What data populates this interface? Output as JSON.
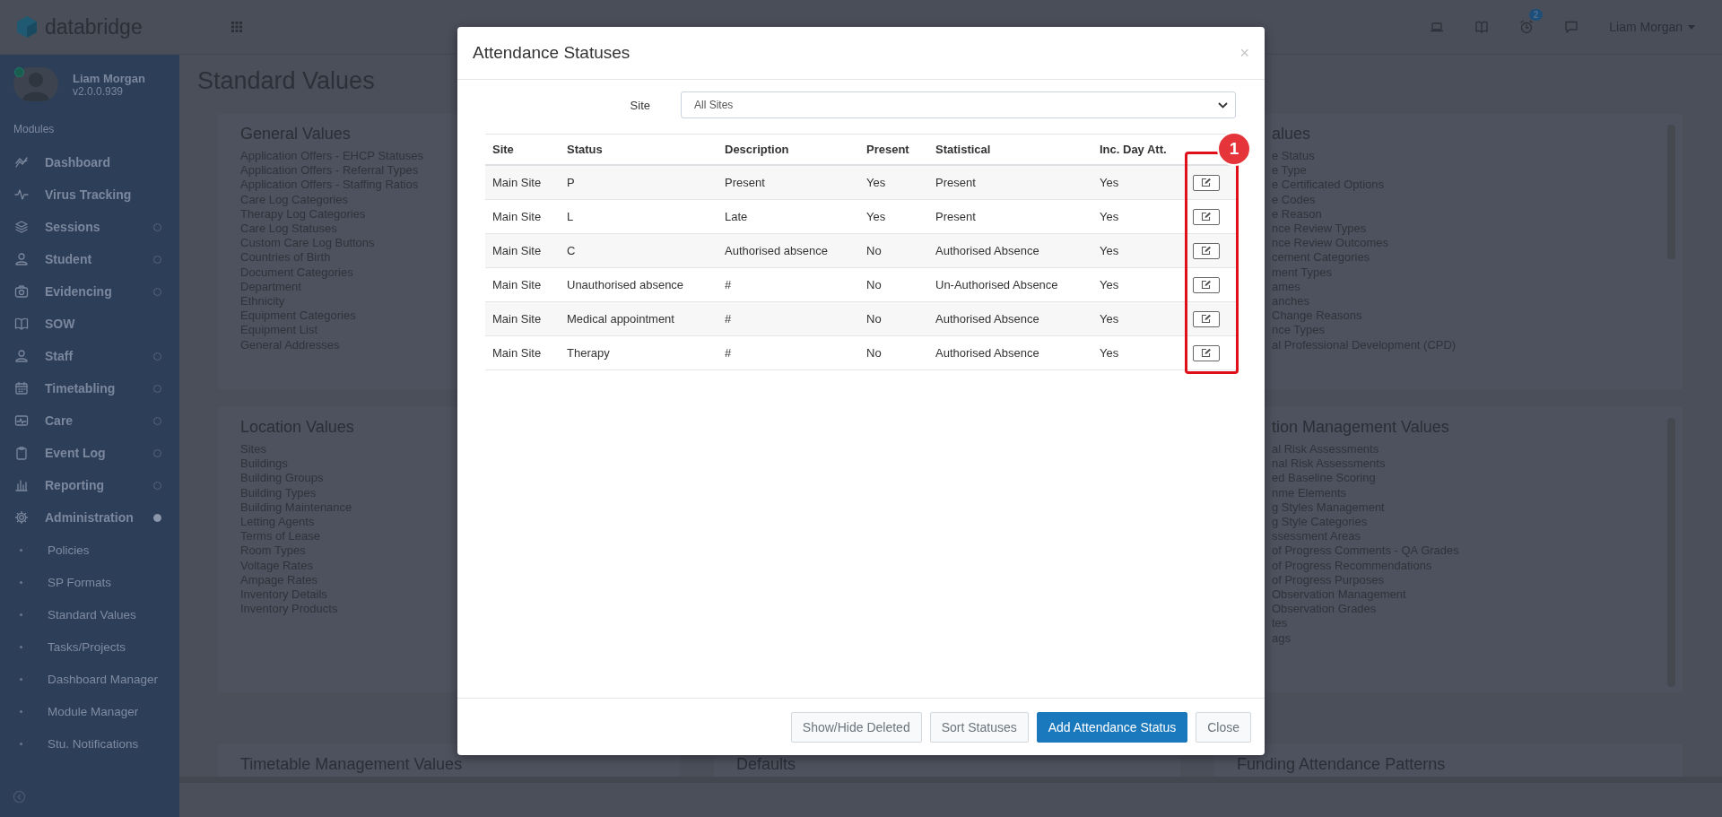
{
  "topbar": {
    "brand": "databridge",
    "notification_count": "2",
    "user_menu": "Liam Morgan"
  },
  "sidebar": {
    "user": {
      "name": "Liam Morgan",
      "version": "v2.0.0.939",
      "online": true
    },
    "section_label": "Modules",
    "items": [
      {
        "label": "Dashboard"
      },
      {
        "label": "Virus Tracking"
      },
      {
        "label": "Sessions",
        "expanded": false
      },
      {
        "label": "Student",
        "expanded": false
      },
      {
        "label": "Evidencing",
        "expanded": false
      },
      {
        "label": "SOW"
      },
      {
        "label": "Staff",
        "expanded": false
      },
      {
        "label": "Timetabling",
        "expanded": false
      },
      {
        "label": "Care",
        "expanded": false
      },
      {
        "label": "Event Log",
        "expanded": false
      },
      {
        "label": "Reporting",
        "expanded": false
      },
      {
        "label": "Administration",
        "expanded": true,
        "children": [
          {
            "label": "Policies"
          },
          {
            "label": "SP Formats"
          },
          {
            "label": "Standard Values"
          },
          {
            "label": "Tasks/Projects"
          },
          {
            "label": "Dashboard Manager"
          },
          {
            "label": "Module Manager"
          },
          {
            "label": "Stu. Notifications"
          }
        ]
      }
    ]
  },
  "page": {
    "title": "Standard Values",
    "left_cards": [
      {
        "title": "General Values",
        "links": [
          "Application Offers - EHCP Statuses",
          "Application Offers - Referral Types",
          "Application Offers - Staffing Ratios",
          "Care Log Categories",
          "Therapy Log Categories",
          "Care Log Statuses",
          "Custom Care Log Buttons",
          "Countries of Birth",
          "Document Categories",
          "Department",
          "Ethnicity",
          "Equipment Categories",
          "Equipment List",
          "General Addresses"
        ]
      },
      {
        "title": "Location Values",
        "links": [
          "Sites",
          "Buildings",
          "Building Groups",
          "Building Types",
          "Building Maintenance",
          "Letting Agents",
          "Terms of Lease",
          "Room Types",
          "Voltage Rates",
          "Ampage Rates",
          "Inventory Details",
          "Inventory Products"
        ]
      }
    ],
    "right_cards": [
      {
        "title": "alues",
        "links": [
          "e Status",
          "e Type",
          "e Certificated Options",
          "e Codes",
          "e Reason",
          "nce Review Types",
          "nce Review Outcomes",
          "cement Categories",
          "ment Types",
          "ames",
          "anches",
          "Change Reasons",
          "nce Types",
          "al Professional Development (CPD)"
        ]
      },
      {
        "title": "tion Management Values",
        "links": [
          "al Risk Assessments",
          "nal Risk Assessments",
          "ed Baseline Scoring",
          "nme Elements",
          "g Styles Management",
          "g Style Categories",
          "ssessment Areas",
          "of Progress Comments - QA Grades",
          "of Progress Recommendations",
          "of Progress Purposes",
          "Observation Management",
          "Observation Grades",
          "tes",
          "ags"
        ]
      }
    ],
    "bottom_headings": [
      "Timetable Management Values",
      "Defaults",
      "Funding Attendance Patterns"
    ]
  },
  "modal": {
    "title": "Attendance Statuses",
    "close": "×",
    "site_label": "Site",
    "site_value": "All Sites",
    "columns": [
      "Site",
      "Status",
      "Description",
      "Present",
      "Statistical",
      "Inc. Day Att."
    ],
    "rows": [
      [
        "Main Site",
        "P",
        "Present",
        "Yes",
        "Present",
        "Yes"
      ],
      [
        "Main Site",
        "L",
        "Late",
        "Yes",
        "Present",
        "Yes"
      ],
      [
        "Main Site",
        "C",
        "Authorised absence",
        "No",
        "Authorised Absence",
        "Yes"
      ],
      [
        "Main Site",
        "Unauthorised absence",
        "#",
        "No",
        "Un-Authorised Absence",
        "Yes"
      ],
      [
        "Main Site",
        "Medical appointment",
        "#",
        "No",
        "Authorised Absence",
        "Yes"
      ],
      [
        "Main Site",
        "Therapy",
        "#",
        "No",
        "Authorised Absence",
        "Yes"
      ]
    ],
    "annotation": {
      "label": "1"
    },
    "buttons": [
      {
        "label": "Show/Hide Deleted",
        "kind": "default"
      },
      {
        "label": "Sort Statuses",
        "kind": "default"
      },
      {
        "label": "Add Attendance Status",
        "kind": "primary"
      },
      {
        "label": "Close",
        "kind": "default"
      }
    ]
  }
}
